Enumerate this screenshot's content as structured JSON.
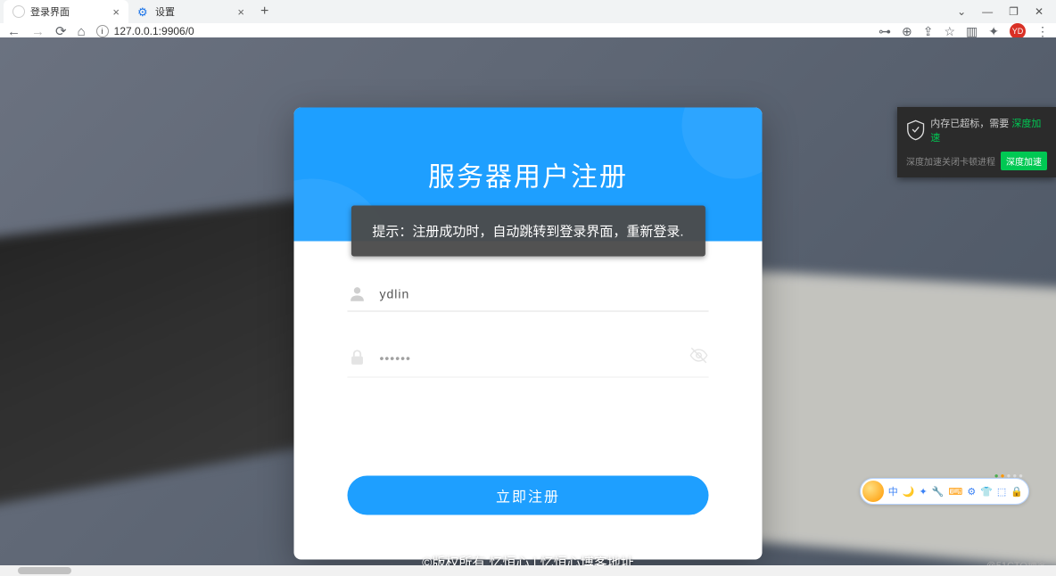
{
  "browser": {
    "tabs": [
      {
        "title": "登录界面",
        "active": true
      },
      {
        "title": "设置",
        "active": false
      }
    ],
    "url": "127.0.0.1:9906/0",
    "avatar_initials": "YD"
  },
  "card": {
    "title": "服务器用户注册",
    "username_value": "ydlin",
    "password_value": "••••••",
    "submit_label": "立即注册"
  },
  "toast": {
    "text": "提示：注册成功时，自动跳转到登录界面，重新登录."
  },
  "footer": "©版权所有 忆恒心 | 忆恒心博客地址",
  "security_popup": {
    "line1_prefix": "内存已超标，需要 ",
    "line1_highlight": "深度加速",
    "line2": "深度加速关闭卡顿进程",
    "button": "深度加速"
  },
  "ime": {
    "icons": [
      "中",
      "🌙",
      "✦",
      "🔧",
      "⌨",
      "⚙",
      "👕",
      "⬚",
      "🔒"
    ]
  },
  "watermark": "@51CTO博客"
}
